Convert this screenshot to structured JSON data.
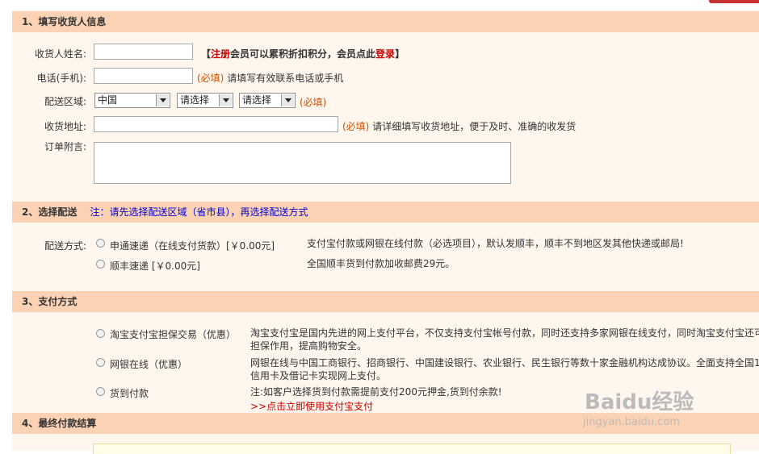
{
  "section1": {
    "title": "1、填写收货人信息",
    "name_label": "收货人姓名:",
    "name_value": "",
    "member_open": "【",
    "register_link": "注册",
    "member_text": "会员可以累积折扣积分，会员点此",
    "login_link": "登录",
    "member_close": "】",
    "phone_label": "电话(手机):",
    "phone_value": "",
    "phone_required": "(必填)",
    "phone_hint": "请填写有效联系电话或手机",
    "region_label": "配送区域:",
    "region_country": "中国",
    "region_province": "请选择",
    "region_city": "请选择",
    "region_required": "(必填)",
    "address_label": "收货地址:",
    "address_value": "",
    "address_required": "(必填)",
    "address_hint": "请详细填写收货地址，便于及时、准确的收发货",
    "note_label": "订单附言:",
    "note_value": ""
  },
  "section2": {
    "title": "2、选择配送",
    "note": "注：请先选择配送区域（省市县），再选择配送方式",
    "method_label": "配送方式:",
    "options": [
      {
        "label": "申通速递（在线支付货款）[￥0.00元]",
        "desc": "支付宝付款或网银在线付款（必选项目），默认发顺丰，顺丰不到地区发其他快递或邮局!"
      },
      {
        "label": "顺丰速递 [￥0.00元]",
        "desc": "全国顺丰货到付款加收邮费29元。"
      }
    ]
  },
  "section3": {
    "title": "3、支付方式",
    "options": [
      {
        "label": "淘宝支付宝担保交易（优惠）",
        "desc1": "淘宝支付宝是国内先进的网上支付平台，不仅支持支付宝帐号付款，同时还支持多家网银在线支付，同时淘宝支付宝还可",
        "desc2": "担保作用，提高购物安全。"
      },
      {
        "label": "网银在线（优惠）",
        "desc1": "网银在线与中国工商银行、招商银行、中国建设银行、农业银行、民生银行等数十家金融机构达成协议。全面支持全国1",
        "desc2": "信用卡及借记卡实现网上支付。"
      },
      {
        "label": "货到付款",
        "desc1": "注:如客户选择货到付款需提前支付200元押金,货到付余款!",
        "desc2": ">>点击立即使用支付宝支付"
      }
    ]
  },
  "section4": {
    "title": "4、最终付款结算"
  },
  "watermark": {
    "logo": "Baidu经验",
    "url": "jingyan.baidu.com"
  }
}
